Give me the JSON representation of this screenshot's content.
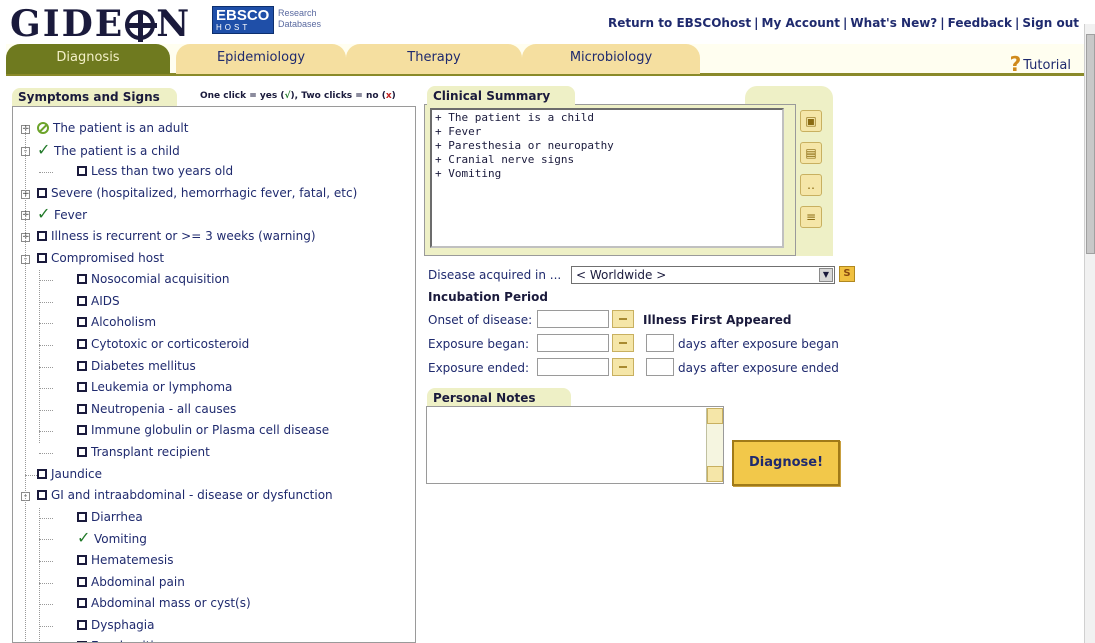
{
  "header": {
    "logo_text": "GIDEON",
    "partner": {
      "brand": "EBSCO",
      "sub": "HOST",
      "tagline_1": "Research",
      "tagline_2": "Databases"
    },
    "links": [
      "Return to EBSCOhost",
      "My Account",
      "What's New?",
      "Feedback",
      "Sign out"
    ]
  },
  "tabs": [
    {
      "label": "Diagnosis",
      "active": true
    },
    {
      "label": "Epidemiology",
      "active": false
    },
    {
      "label": "Therapy",
      "active": false
    },
    {
      "label": "Microbiology",
      "active": false
    }
  ],
  "tutorial_label": "Tutorial",
  "symptoms": {
    "title": "Symptoms and Signs",
    "hint_prefix": "One click = yes (",
    "hint_mid": "), Two clicks = no (",
    "hint_suffix": ")",
    "hint_yes_glyph": "√",
    "hint_no_glyph": "x",
    "items": [
      {
        "label": "The patient is an adult",
        "state": "no",
        "level": 0,
        "expander": "+"
      },
      {
        "label": "The patient is a child",
        "state": "yes",
        "level": 0,
        "expander": "-"
      },
      {
        "label": "Less than two years old",
        "state": "unchecked",
        "level": 1,
        "expander": ""
      },
      {
        "label": "Severe (hospitalized, hemorrhagic fever, fatal, etc)",
        "state": "unchecked",
        "level": 0,
        "expander": "+"
      },
      {
        "label": "Fever",
        "state": "yes",
        "level": 0,
        "expander": "+"
      },
      {
        "label": "Illness is recurrent or >= 3 weeks (warning)",
        "state": "unchecked",
        "level": 0,
        "expander": "+"
      },
      {
        "label": "Compromised host",
        "state": "unchecked",
        "level": 0,
        "expander": "-"
      },
      {
        "label": "Nosocomial acquisition",
        "state": "unchecked",
        "level": 1,
        "expander": ""
      },
      {
        "label": "AIDS",
        "state": "unchecked",
        "level": 1,
        "expander": ""
      },
      {
        "label": "Alcoholism",
        "state": "unchecked",
        "level": 1,
        "expander": ""
      },
      {
        "label": "Cytotoxic or corticosteroid",
        "state": "unchecked",
        "level": 1,
        "expander": ""
      },
      {
        "label": "Diabetes mellitus",
        "state": "unchecked",
        "level": 1,
        "expander": ""
      },
      {
        "label": "Leukemia or lymphoma",
        "state": "unchecked",
        "level": 1,
        "expander": ""
      },
      {
        "label": "Neutropenia - all causes",
        "state": "unchecked",
        "level": 1,
        "expander": ""
      },
      {
        "label": "Immune globulin or Plasma cell disease",
        "state": "unchecked",
        "level": 1,
        "expander": ""
      },
      {
        "label": "Transplant recipient",
        "state": "unchecked",
        "level": 1,
        "expander": ""
      },
      {
        "label": "Jaundice",
        "state": "unchecked",
        "level": 0,
        "expander": ""
      },
      {
        "label": "GI and intraabdominal - disease or dysfunction",
        "state": "unchecked",
        "level": 0,
        "expander": "-"
      },
      {
        "label": "Diarrhea",
        "state": "unchecked",
        "level": 1,
        "expander": ""
      },
      {
        "label": "Vomiting",
        "state": "yes",
        "level": 1,
        "expander": ""
      },
      {
        "label": "Hematemesis",
        "state": "unchecked",
        "level": 1,
        "expander": ""
      },
      {
        "label": "Abdominal pain",
        "state": "unchecked",
        "level": 1,
        "expander": ""
      },
      {
        "label": "Abdominal mass or cyst(s)",
        "state": "unchecked",
        "level": 1,
        "expander": ""
      },
      {
        "label": "Dysphagia",
        "state": "unchecked",
        "level": 1,
        "expander": ""
      },
      {
        "label": "Esophagitis",
        "state": "unchecked",
        "level": 1,
        "expander": ""
      }
    ]
  },
  "clinical_summary": {
    "title": "Clinical Summary",
    "lines": [
      "+ The patient is a child",
      "+ Fever",
      "+ Paresthesia or neuropathy",
      "+ Cranial nerve signs",
      "+ Vomiting"
    ]
  },
  "form": {
    "acquired_label": "Disease acquired in ...",
    "acquired_value": "< Worldwide >",
    "s_button": "S",
    "incubation_title": "Incubation Period",
    "onset_label": "Onset of disease:",
    "illness_first": "Illness First Appeared",
    "exp_began_label": "Exposure began:",
    "exp_began_suffix": "days after exposure began",
    "exp_ended_label": "Exposure ended:",
    "exp_ended_suffix": "days after exposure ended"
  },
  "notes": {
    "title": "Personal Notes"
  },
  "diagnose_label": "Diagnose!",
  "colors": {
    "tab_active": "#6f7a1f",
    "tab": "#f5dfa0",
    "panel": "#eef0c6",
    "check": "#227a2a",
    "button": "#f2c84a"
  }
}
